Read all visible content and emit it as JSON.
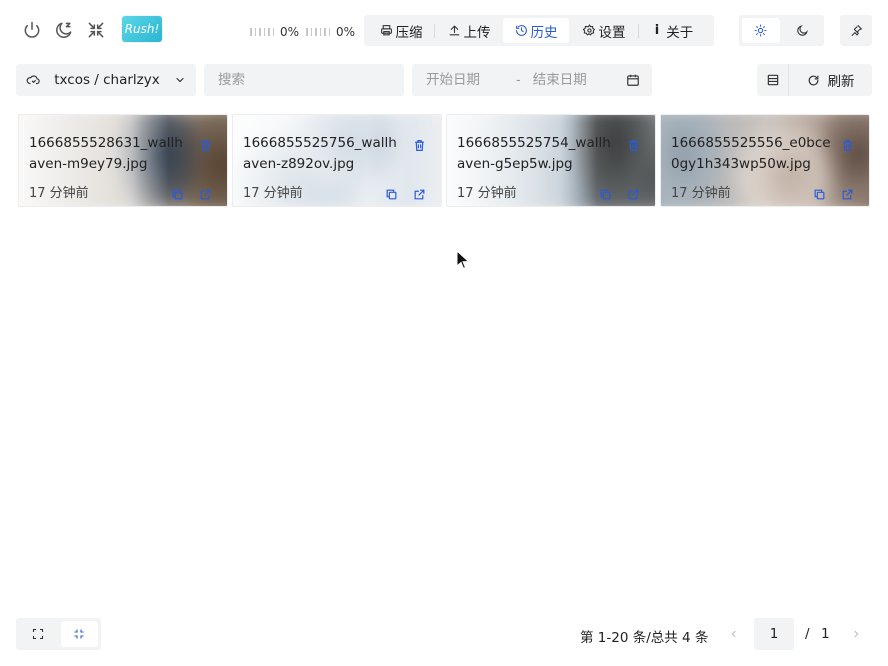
{
  "toolbar": {
    "progress_1": "0%",
    "progress_2": "0%",
    "logo_text": "Rush!"
  },
  "nav": {
    "tabs": [
      {
        "label": "压缩",
        "icon": "printer-icon"
      },
      {
        "label": "上传",
        "icon": "upload-icon"
      },
      {
        "label": "历史",
        "icon": "history-clock-icon",
        "active": true
      },
      {
        "label": "设置",
        "icon": "gear-icon"
      },
      {
        "label": "关于",
        "icon": "info-icon"
      }
    ]
  },
  "filters": {
    "repo": "txcos / charlzyx",
    "search_placeholder": "搜索",
    "start_placeholder": "开始日期",
    "end_placeholder": "结束日期",
    "date_separator": "-",
    "refresh_label": "刷新"
  },
  "cards": [
    {
      "name": "1666855528631_wallhaven-m9ey79.jpg",
      "time": "17 分钟前"
    },
    {
      "name": "1666855525756_wallhaven-z892ov.jpg",
      "time": "17 分钟前"
    },
    {
      "name": "1666855525754_wallhaven-g5ep5w.jpg",
      "time": "17 分钟前"
    },
    {
      "name": "1666855525556_e0bce0gy1h343wp50w.jpg",
      "time": "17 分钟前"
    }
  ],
  "pagination": {
    "total_text": "第 1-20 条/总共 4 条",
    "current_page": "1",
    "separator": "/",
    "total_pages": "1"
  },
  "colors": {
    "accent": "#2a5bd7",
    "panel": "#f2f3f5",
    "logo": "#2bb6d2"
  }
}
